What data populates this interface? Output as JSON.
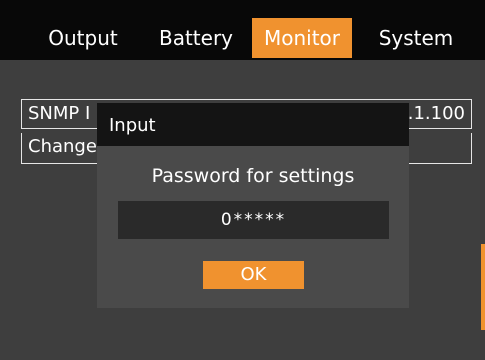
{
  "tabs": {
    "output": "Output",
    "battery": "Battery",
    "monitor": "Monitor",
    "system": "System",
    "active": "Monitor"
  },
  "fields": {
    "snmp_label": "SNMP I",
    "snmp_value": ".1.100",
    "change_label": "Change"
  },
  "dialog": {
    "title": "Input",
    "prompt": "Password for settings",
    "password_value": "0*****",
    "ok_label": "OK"
  },
  "colors": {
    "accent": "#f0922f",
    "background": "#3e3e3e",
    "header": "#080808"
  }
}
